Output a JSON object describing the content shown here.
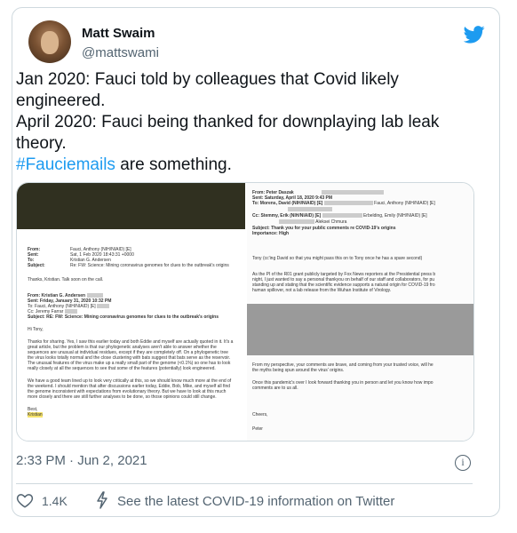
{
  "user": {
    "name": "Matt Swaim",
    "handle": "@mattswami"
  },
  "tweet": {
    "line1": "Jan 2020: Fauci told by colleagues that Covid likely engineered.",
    "line2": "April 2020: Fauci being thanked for downplaying lab leak theory.",
    "hashtag": "#Fauciemails",
    "line3_rest": " are something."
  },
  "media": {
    "left_doc": {
      "from_label": "From:",
      "from_value": "Fauci, Anthony (NIH/NIAID) [E]",
      "sent_label": "Sent:",
      "sent_value": "Sat, 1 Feb 2020 18:43:31 +0000",
      "to_label": "To:",
      "to_value": "Kristian G. Andersen",
      "subject_label": "Subject:",
      "subject_value": "Re: FW: Science: Mining coronavirus genomes for clues to the outbreak's origins",
      "thanks": "Thanks, Kristian. Talk soon on the call.",
      "from2": "From: Kristian G. Andersen",
      "sent2": "Sent: Friday, January 31, 2020 10:32 PM",
      "to2": "To: Fauci, Anthony (NIH/NIAID) [E]",
      "cc2": "Cc: Jeremy Farrar",
      "subject2": "Subject: RE: FW: Science: Mining coronavirus genomes for clues to the outbreak's origins",
      "greeting": "Hi Tony,",
      "p1": [
        "Thanks for sharing. Yes, I saw this earlier today and both Eddie and myself are actually quoted in it. It's a",
        "great article, but the problem is that our phylogenetic analyses aren't able to answer whether the",
        "sequences are unusual at individual residues, except if they are completely off. On a phylogenetic tree",
        "the virus looks totally normal and the close clustering with bats suggest that bats serve as the reservoir.",
        "The unusual features of the virus make up a really small part of the genome (<0.1%) so one has to look",
        "really closely at all the sequences to see that some of the features (potentially) look engineered."
      ],
      "p2": [
        "We have a good team lined up to look very critically at this, so we should know much more at the end of",
        "the weekend. I should mention that after discussions earlier today, Eddie, Bob, Mike, and myself all find",
        "the genome inconsistent with expectations from evolutionary theory. But we have to look at this much",
        "more closely and there are still further analyses to be done, so those opinions could still change."
      ],
      "signoff": "Best,",
      "signature": "Kristian"
    },
    "right_doc": {
      "from": "From: Peter Daszak",
      "sent": "Sent: Saturday, April 18, 2020 9:43 PM",
      "to": "To: Morens, David (NIH/NIAID) [E]",
      "to_cont": "Fauci, Anthony (NIH/NIAID) [E]",
      "cc": "Cc: Stemmy, Erik (NIH/NIAID) [E]",
      "cc_cont": "Erbelding, Emily (NIH/NIAID) [E]",
      "cc_more": "Aleksei Chmura",
      "subject": "Subject: Thank you for your public comments re COVID-19's origins",
      "importance": "Importance: High",
      "tony_line": "Tony (cc'ing David so that you might pass this on to Tony once he has a spare second)",
      "p1": [
        "As the PI of the R01 grant publicly targeted by Fox News reporters at the Presidential press b",
        "night, I just wanted to say a personal thankyou on behalf of our staff and collaborators, for pu",
        "standing up and stating that the scientific evidence supports a natural origin for COVID-19 fro",
        "human spillover, not a lab release from the Wuhan Institute of Virology."
      ],
      "p2": [
        "From my perspective, your comments are brave, and coming from your trusted voice, will he",
        "the myths being spun around the virus' origins."
      ],
      "p3": [
        "Once this pandemic's over I look forward thanking you in person and let you know how impo",
        "comments are to us all."
      ],
      "signoff": "Cheers,",
      "signature": "Peter"
    }
  },
  "timestamp": "2:33 PM · Jun 2, 2021",
  "likes": "1.4K",
  "covid_link": "See the latest COVID-19 information on Twitter",
  "colors": {
    "link": "#1d9bf0",
    "muted": "#536471",
    "border": "#cfd9de"
  },
  "icons": [
    "twitter-bird-icon",
    "heart-icon",
    "lightning-icon",
    "info-icon"
  ]
}
